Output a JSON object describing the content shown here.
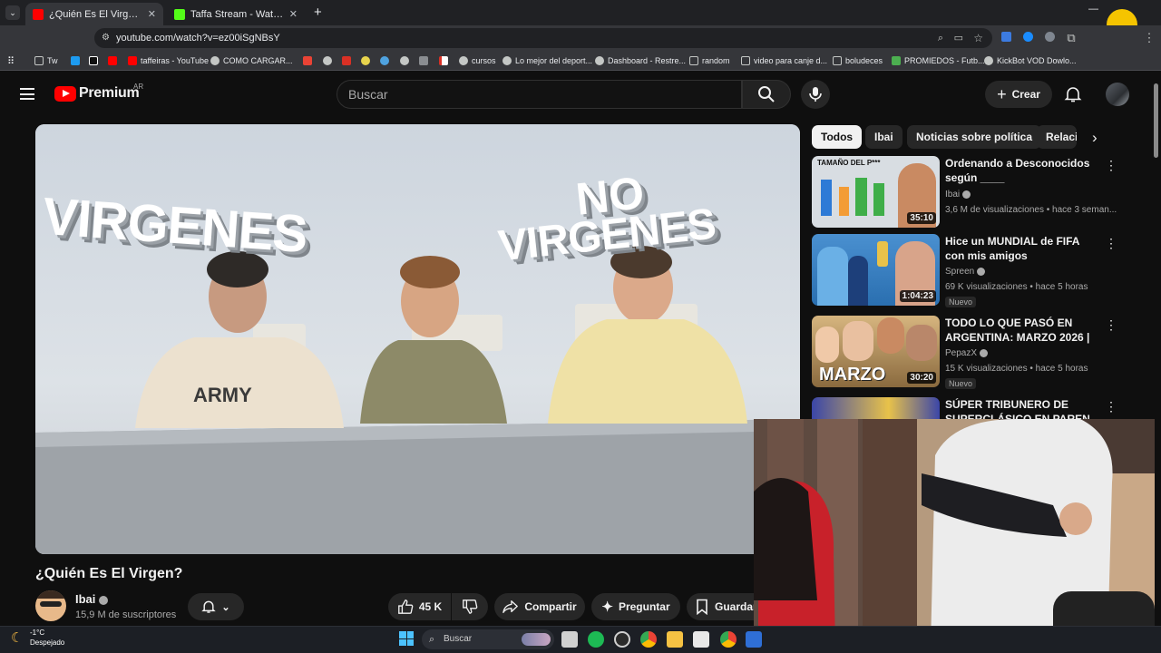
{
  "browser": {
    "tabs": [
      {
        "title": "¿Quién Es El Virgen? - YouTube",
        "close": "✕"
      },
      {
        "title": "Taffa Stream - Watch Live on Ki",
        "close": "✕"
      }
    ],
    "new_tab": "+",
    "url": "youtube.com/watch?v=ez00iSgNBsY",
    "bookmarks": [
      "Tw",
      "taffeiras - YouTube",
      "COMO CARGAR...",
      "cursos",
      "Lo mejor del deport...",
      "Dashboard - Restre...",
      "random",
      "video para canje d...",
      "boludeces",
      "PROMIEDOS - Futb...",
      "KickBot VOD Dowlo..."
    ]
  },
  "youtube": {
    "logo_text": "Premium",
    "country": "AR",
    "search_placeholder": "Buscar",
    "create_label": "Crear",
    "video": {
      "thumb_text_left": "VIRGENES",
      "thumb_text_right_top": "NO",
      "thumb_text_right_bottom": "VIRGENES",
      "shirt_text": "ARMY",
      "title": "¿Quién Es El Virgen?",
      "channel": "Ibai",
      "subscribers": "15,9 M de suscriptores",
      "likes": "45 K",
      "share": "Compartir",
      "ask": "Preguntar",
      "save": "Guardar"
    },
    "chips": [
      "Todos",
      "Ibai",
      "Noticias sobre política",
      "Relacio"
    ],
    "recommendations": [
      {
        "title": "Ordenando a Desconocidos según ____",
        "channel": "Ibai",
        "meta": "3,6 M de visualizaciones • hace 3 seman...",
        "duration": "35:10",
        "badge": "",
        "thumb_text": "TAMAÑO DEL P***",
        "thumb_color": "#d8dde2"
      },
      {
        "title": "Hice un MUNDIAL de FIFA con mis amigos",
        "channel": "Spreen",
        "meta": "69 K visualizaciones • hace 5 horas",
        "duration": "1:04:23",
        "badge": "Nuevo",
        "thumb_text": "",
        "thumb_color": "#2a6fb0"
      },
      {
        "title": "TODO LO QUE PASÓ EN ARGENTINA: MARZO 2026 | ...",
        "channel": "PepazX",
        "meta": "15 K visualizaciones • hace 5 horas",
        "duration": "30:20",
        "badge": "Nuevo",
        "thumb_text": "MARZO",
        "thumb_color": "#b98b4b"
      },
      {
        "title": "SÚPER TRIBUNERO DE SUPERCLÁSICO EN PAREN LA",
        "channel": "",
        "meta": "",
        "duration": "",
        "badge": "",
        "thumb_text": "",
        "thumb_color": "#3b46a8"
      }
    ]
  },
  "taskbar": {
    "weather_temp": "-1°C",
    "weather_desc": "Despejado",
    "search": "Buscar"
  }
}
